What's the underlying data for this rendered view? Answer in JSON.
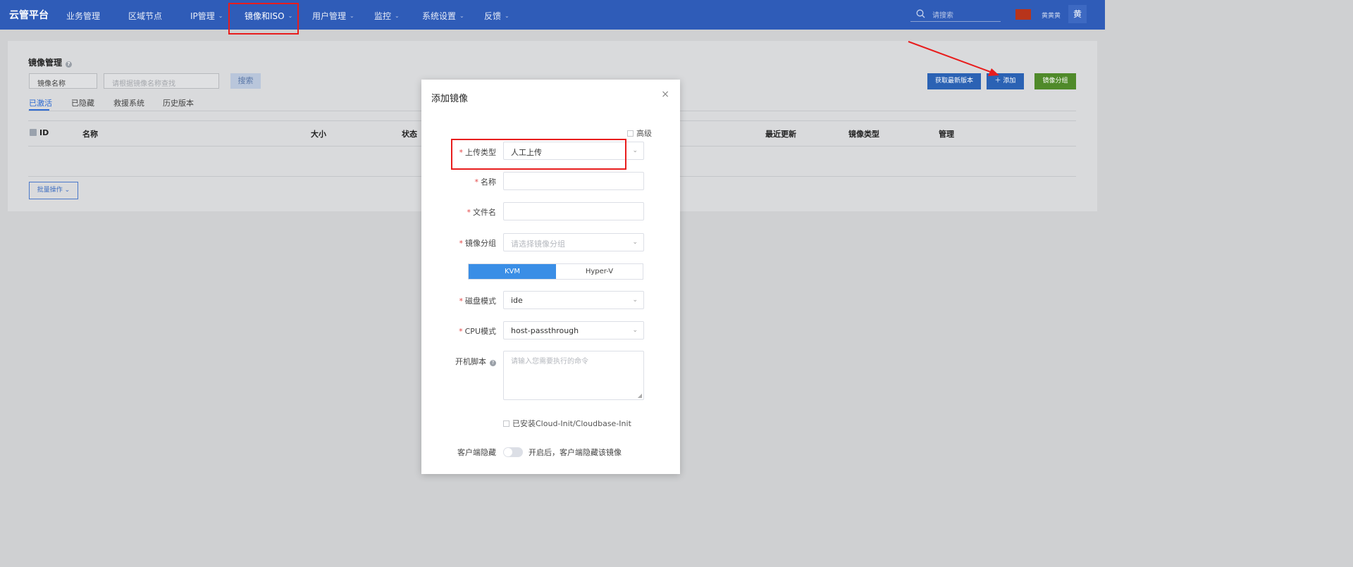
{
  "nav": {
    "brand": "云管平台",
    "items": [
      {
        "label": "业务管理",
        "has_menu": false
      },
      {
        "label": "区域节点",
        "has_menu": false
      },
      {
        "label": "IP管理",
        "has_menu": true
      },
      {
        "label": "镜像和ISO",
        "has_menu": true,
        "active": true
      },
      {
        "label": "用户管理",
        "has_menu": true
      },
      {
        "label": "监控",
        "has_menu": true
      },
      {
        "label": "系统设置",
        "has_menu": true
      },
      {
        "label": "反馈",
        "has_menu": true
      }
    ],
    "search_placeholder": "请搜索",
    "username": "黄黄黄",
    "avatar": "黄"
  },
  "page": {
    "title": "镜像管理",
    "filter_select": "镜像名称",
    "search_placeholder": "请根据镜像名称查找",
    "search_button": "搜索",
    "buttons": {
      "fetch_latest": "获取最新版本",
      "add": "添加",
      "group": "镜像分组"
    },
    "tabs": [
      "已激活",
      "已隐藏",
      "救援系统",
      "历史版本"
    ],
    "table_headers": [
      "ID",
      "名称",
      "大小",
      "状态",
      "最近更新",
      "镜像类型",
      "管理"
    ],
    "batch_button": "批量操作"
  },
  "modal": {
    "title": "添加镜像",
    "advanced": "高级",
    "fields": {
      "upload_type": {
        "label": "上传类型",
        "value": "人工上传"
      },
      "name": {
        "label": "名称"
      },
      "filename": {
        "label": "文件名"
      },
      "group": {
        "label": "镜像分组",
        "placeholder": "请选择镜像分组"
      },
      "disk_mode": {
        "label": "磁盘模式",
        "value": "ide"
      },
      "cpu_mode": {
        "label": "CPU模式",
        "value": "host-passthrough"
      },
      "boot_script": {
        "label": "开机脚本",
        "placeholder": "请输入您需要执行的命令"
      },
      "client_hide": {
        "label": "客户端隐藏",
        "text": "开启后，客户端隐藏该镜像"
      }
    },
    "hypervisor": [
      "KVM",
      "Hyper-V"
    ],
    "cloud_init": "已安装Cloud-Init/Cloudbase-Init"
  },
  "colors": {
    "nav_bg": "#2f5cb8",
    "primary": "#3a8ee6",
    "danger_highlight": "#e81d1d",
    "green": "#5a9e32"
  }
}
